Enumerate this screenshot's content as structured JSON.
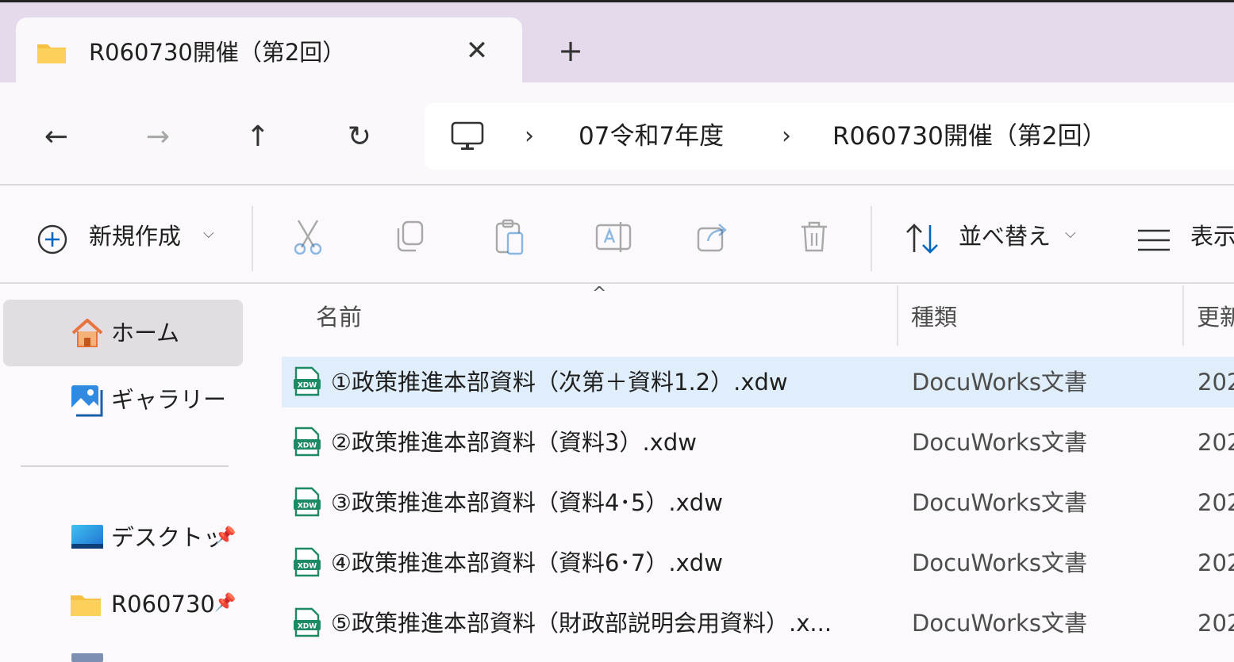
{
  "tab": {
    "title": "R060730開催（第2回）",
    "close": "✕",
    "new_tab": "+"
  },
  "nav": {
    "back": "←",
    "forward": "→",
    "up": "↑",
    "refresh": "↻"
  },
  "breadcrumb": {
    "sep": "›",
    "items": [
      "07令和7年度",
      "R060730開催（第2回）"
    ]
  },
  "toolbar": {
    "new_label": "新規作成",
    "sort_label": "並べ替え",
    "view_label": "表示",
    "chevron": "⌵"
  },
  "sidebar": {
    "items": [
      {
        "label": "ホーム"
      },
      {
        "label": "ギャラリー"
      },
      {
        "label": "デスクトップ"
      },
      {
        "label": "R060730"
      }
    ]
  },
  "columns": {
    "name": "名前",
    "type": "種類",
    "modified": "更新日時",
    "sort_caret": "^"
  },
  "files": [
    {
      "name": "①政策推進本部資料（次第＋資料1.2）.xdw",
      "type": "DocuWorks文書",
      "date": "202"
    },
    {
      "name": "②政策推進本部資料（資料3）.xdw",
      "type": "DocuWorks文書",
      "date": "202"
    },
    {
      "name": "③政策推進本部資料（資料4･5）.xdw",
      "type": "DocuWorks文書",
      "date": "202"
    },
    {
      "name": "④政策推進本部資料（資料6･7）.xdw",
      "type": "DocuWorks文書",
      "date": "202"
    },
    {
      "name": "⑤政策推進本部資料（財政部説明会用資料）.x...",
      "type": "DocuWorks文書",
      "date": "202"
    }
  ],
  "colors": {
    "folder": "#f6c142",
    "accent": "#0067c0",
    "xdw": "#1e8a63",
    "selection": "#dfeefa"
  },
  "icons": [
    "folder-icon",
    "pc-icon",
    "cut-icon",
    "copy-icon",
    "paste-icon",
    "rename-icon",
    "share-icon",
    "delete-icon",
    "sort-icon",
    "view-icon",
    "home-icon",
    "gallery-icon",
    "desktop-icon",
    "pin-icon",
    "xdw-file-icon"
  ]
}
